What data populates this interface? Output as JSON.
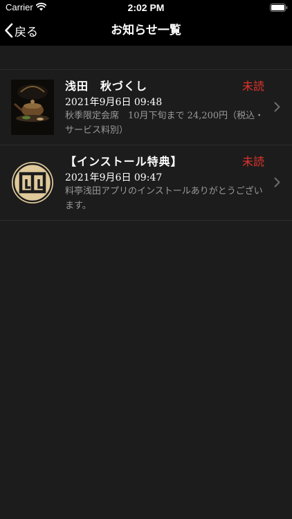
{
  "status_bar": {
    "carrier": "Carrier",
    "time": "2:02 PM",
    "wifi_icon": "wifi-icon",
    "battery_icon": "battery-icon"
  },
  "nav": {
    "back_label": "戻る",
    "back_icon": "chevron-left-icon",
    "title": "お知らせ一覧"
  },
  "colors": {
    "background": "#1c1c1c",
    "bar_background": "#000000",
    "unread": "#e0342c",
    "secondary_text": "#9a9a9a",
    "thumb_emblem": "#e0c99a"
  },
  "notices": [
    {
      "title": "浅田　秋づくし",
      "status": "未読",
      "date": "2021年9月6日 09:48",
      "body": "秋季限定会席　10月下旬まで 24,200円（税込・サービス料別）",
      "thumbnail": "teapot-photo",
      "chevron_icon": "chevron-right-icon"
    },
    {
      "title": "【インストール特典】",
      "status": "未読",
      "date": "2021年9月6日 09:47",
      "body": "料亭浅田アプリのインストールありがとうございます。",
      "thumbnail": "restaurant-crest-logo",
      "chevron_icon": "chevron-right-icon"
    }
  ]
}
